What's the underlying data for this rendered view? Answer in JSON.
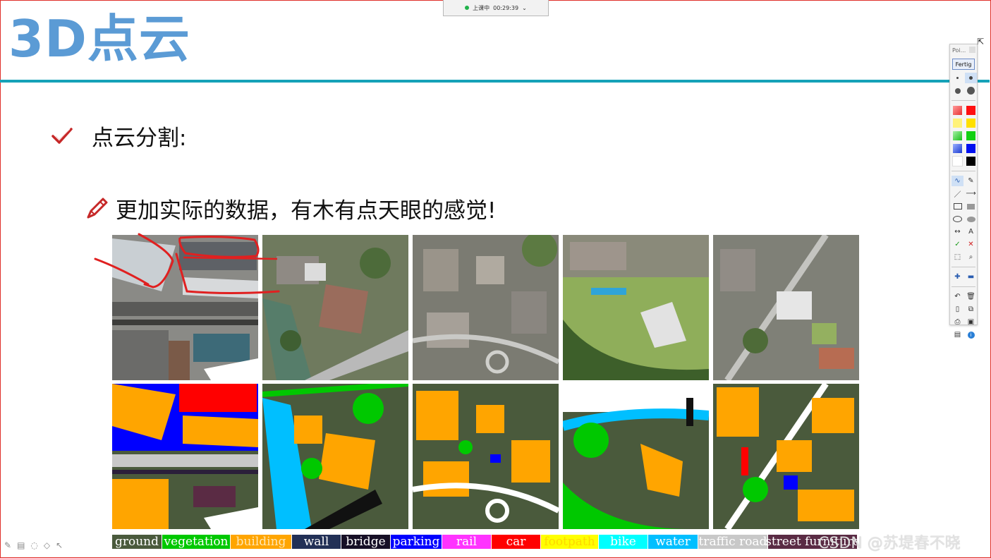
{
  "session": {
    "status": "上课中",
    "time": "00:29:39",
    "chevron": "⌄"
  },
  "slide": {
    "title": "3D点云",
    "bullet1": "点云分割:",
    "bullet2": "更加实际的数据，有木有点天眼的感觉!"
  },
  "legend": [
    {
      "label": "ground",
      "color": "#4a5a3c",
      "text": "#ffffff",
      "w": 70
    },
    {
      "label": "vegetation",
      "color": "#00c800",
      "text": "#ffffff",
      "w": 96
    },
    {
      "label": "building",
      "color": "#ffa500",
      "text": "#ffe6b3",
      "w": 86
    },
    {
      "label": "wall",
      "color": "#223056",
      "text": "#ffffff",
      "w": 69
    },
    {
      "label": "bridge",
      "color": "#160f26",
      "text": "#ffffff",
      "w": 69
    },
    {
      "label": "parking",
      "color": "#0000ff",
      "text": "#ffffff",
      "w": 72
    },
    {
      "label": "rail",
      "color": "#ff33ff",
      "text": "#ffffff",
      "w": 69
    },
    {
      "label": "car",
      "color": "#ff0000",
      "text": "#ffffff",
      "w": 69
    },
    {
      "label": "footpath",
      "color": "#ffff00",
      "text": "#ffd700",
      "w": 81
    },
    {
      "label": "bike",
      "color": "#00ffff",
      "text": "#ffffff",
      "w": 69
    },
    {
      "label": "water",
      "color": "#00bfff",
      "text": "#ffffff",
      "w": 70
    },
    {
      "label": "traffic road",
      "color": "#c8c8c8",
      "text": "#ffffff",
      "w": 98
    },
    {
      "label": "street furniture",
      "color": "#5a2b44",
      "text": "#ffffff",
      "w": 126
    }
  ],
  "toolbar": {
    "title": "Poi...",
    "done_button": "Fertig",
    "text_tool": "A"
  },
  "watermark": "CSDN @苏堤春不晓",
  "colors": {
    "title_blue": "#5b9bd5",
    "rule_teal": "#16a2b8",
    "frame_red": "#e0302a",
    "annotation_red": "#e02020"
  }
}
